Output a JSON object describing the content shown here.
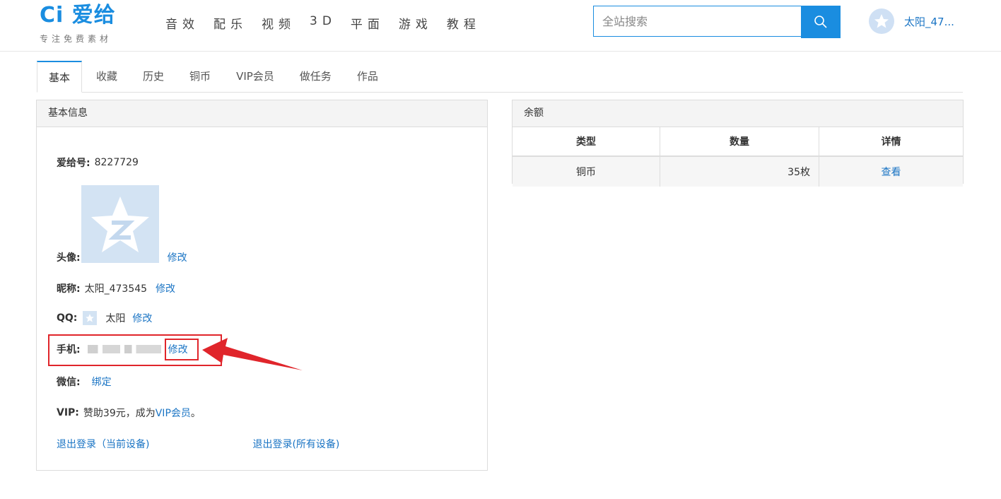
{
  "header": {
    "logo_main": "Ci 爱给",
    "logo_sub": "专注免费素材",
    "nav": [
      "音效",
      "配乐",
      "视频",
      "3D",
      "平面",
      "游戏",
      "教程"
    ],
    "search_placeholder": "全站搜索",
    "user_name": "太阳_47..."
  },
  "tabs": [
    "基本",
    "收藏",
    "历史",
    "铜币",
    "VIP会员",
    "做任务",
    "作品"
  ],
  "basic_info": {
    "title": "基本信息",
    "id_label": "爱给号:",
    "id_value": "8227729",
    "avatar_label": "头像:",
    "avatar_edit": "修改",
    "nickname_label": "昵称:",
    "nickname_value": "太阳_473545",
    "nickname_edit": "修改",
    "qq_label": "QQ:",
    "qq_value": "太阳",
    "qq_edit": "修改",
    "phone_label": "手机:",
    "phone_edit": "修改",
    "wechat_label": "微信:",
    "wechat_bind": "绑定",
    "vip_label": "VIP:",
    "vip_text": "赞助39元，成为",
    "vip_link": "VIP会员",
    "vip_end": "。",
    "logout_current": "退出登录（当前设备)",
    "logout_all": "退出登录(所有设备)"
  },
  "balance": {
    "title": "余额",
    "columns": [
      "类型",
      "数量",
      "详情"
    ],
    "rows": [
      {
        "type": "铜币",
        "amount": "35枚",
        "detail": "查看"
      }
    ]
  },
  "colors": {
    "accent": "#1a8de0",
    "link": "#1a74c4",
    "annotation": "#e0252b"
  }
}
